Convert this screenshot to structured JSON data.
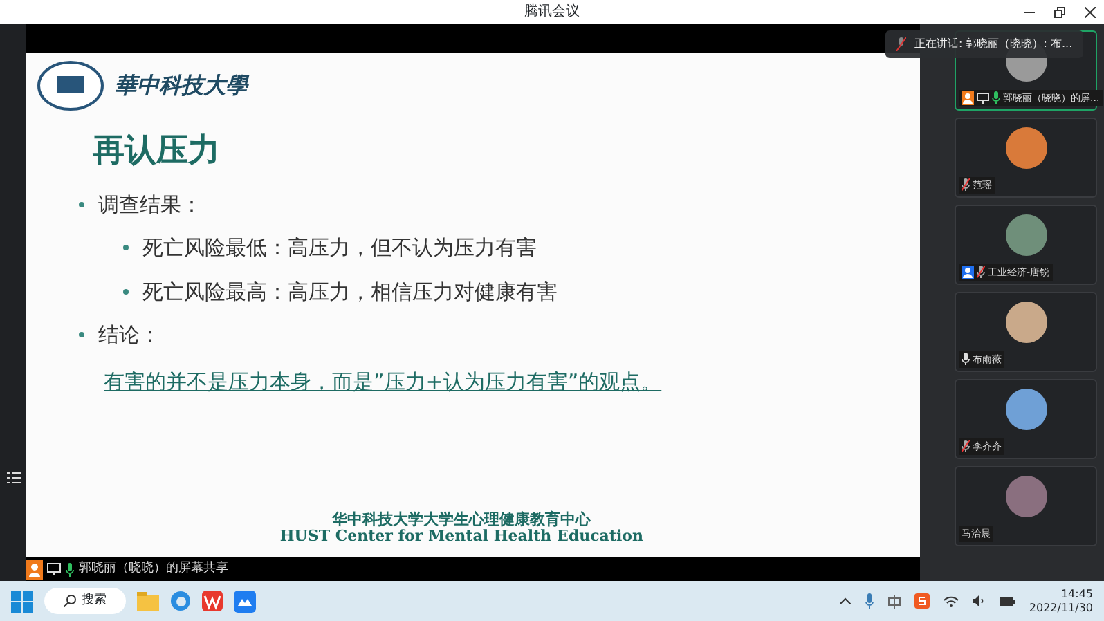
{
  "window": {
    "title": "腾讯会议"
  },
  "slide": {
    "university": "華中科技大學",
    "title": "再认压力",
    "bullets": [
      {
        "text": "调查结果：",
        "children": [
          {
            "text": "死亡风险最低：高压力，但不认为压力有害"
          },
          {
            "text": "死亡风险最高：高压力，相信压力对健康有害"
          }
        ]
      },
      {
        "text": "结论："
      }
    ],
    "conclusion": "有害的并不是压力本身，而是”压力+认为压力有害”的观点。",
    "footer_cn": "华中科技大学大学生心理健康教育中心",
    "footer_en": "HUST Center for Mental Health Education"
  },
  "speaking_toast": "正在讲话: 郭晓丽（晓晓）: 布...",
  "participants": [
    {
      "name": "郭晓丽（晓晓）的屏...",
      "selected": true,
      "color": "#f07a1c",
      "muted": false,
      "speaking": true,
      "sharing": true
    },
    {
      "name": "范瑶",
      "selected": false,
      "muted": true,
      "sharing": false
    },
    {
      "name": "工业经济-唐锐",
      "selected": false,
      "color": "#1f6ff0",
      "muted": true,
      "sharing": false
    },
    {
      "name": "布雨薇",
      "selected": false,
      "muted": false,
      "speaking": false,
      "sharing": false
    },
    {
      "name": "李齐齐",
      "selected": false,
      "muted": true,
      "sharing": false
    },
    {
      "name": "马治晨",
      "selected": false,
      "sharing": false
    }
  ],
  "share_label": "郭晓丽（晓晓）的屏幕共享",
  "taskbar": {
    "search": "搜索",
    "time": "14:45",
    "date": "2022/11/30"
  }
}
